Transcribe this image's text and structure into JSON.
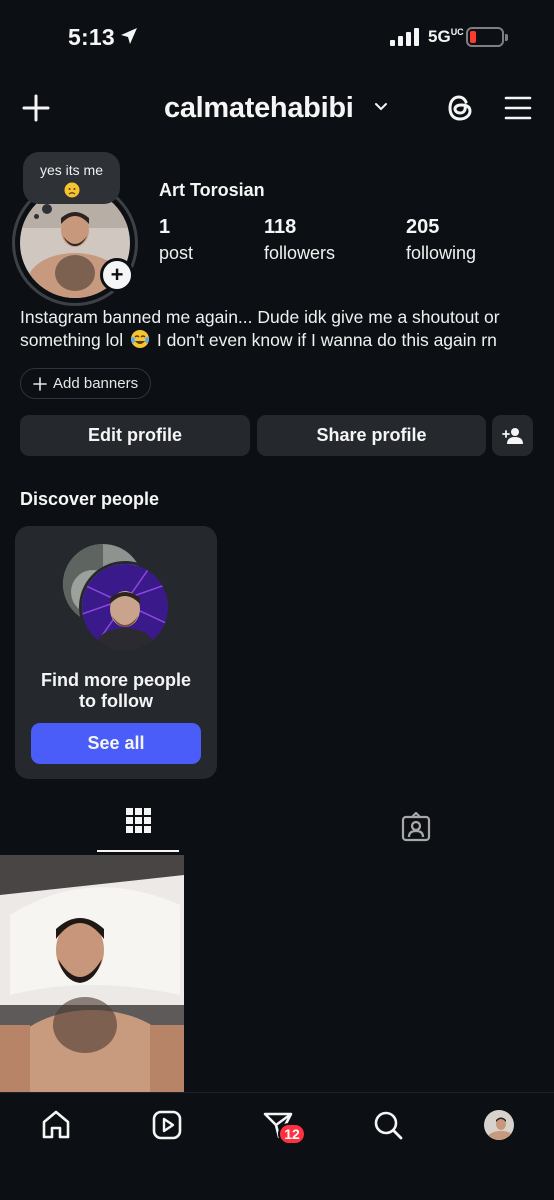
{
  "status_bar": {
    "time": "5:13",
    "network": "5G",
    "network_suffix": "UC"
  },
  "header": {
    "username": "calmatehabibi"
  },
  "profile": {
    "note": "yes its me",
    "display_name": "Art Torosian",
    "stats": [
      {
        "value": "1",
        "label": "post"
      },
      {
        "value": "118",
        "label": "followers"
      },
      {
        "value": "205",
        "label": "following"
      }
    ],
    "bio_line1": "Instagram banned me again... Dude idk give me a shoutout or",
    "bio_line2_a": "something lol",
    "bio_line2_b": "I don't even know if I wanna do this again rn",
    "add_banners": "Add banners",
    "edit_profile": "Edit profile",
    "share_profile": "Share profile"
  },
  "discover": {
    "title": "Discover people",
    "card_text_1": "Find more people",
    "card_text_2": "to follow",
    "see_all": "See all"
  },
  "bottom_nav": {
    "messages_badge": "12"
  },
  "colors": {
    "background": "#0c1014",
    "button": "#25292e",
    "accent": "#4a5df9",
    "badge": "#ff3040"
  }
}
